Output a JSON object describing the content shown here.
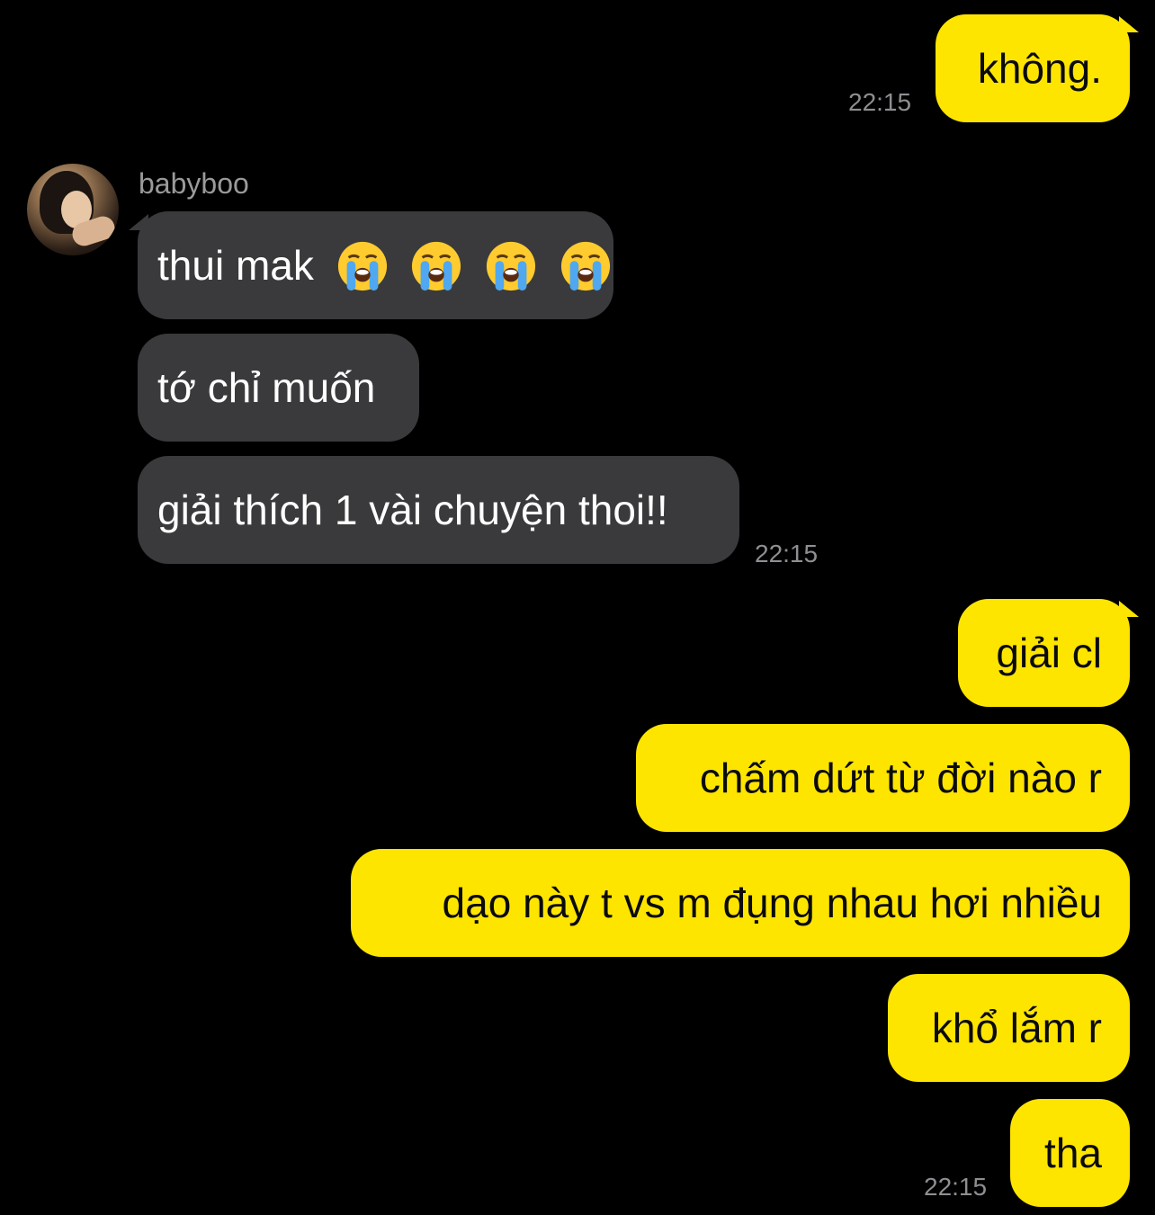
{
  "conversation": {
    "contact_name": "babyboo",
    "messages": [
      {
        "id": "m1",
        "from": "me",
        "text": "không."
      },
      {
        "id": "m2",
        "from": "them",
        "text": "thui mak",
        "emoji": [
          "loudly-crying-face",
          "loudly-crying-face",
          "loudly-crying-face",
          "loudly-crying-face"
        ]
      },
      {
        "id": "m3",
        "from": "them",
        "text": "tớ chỉ muốn"
      },
      {
        "id": "m4",
        "from": "them",
        "text": "giải thích 1 vài chuyện thoi!!"
      },
      {
        "id": "m5",
        "from": "me",
        "text": "giải cl"
      },
      {
        "id": "m6",
        "from": "me",
        "text": "chấm dứt từ đời nào r"
      },
      {
        "id": "m7",
        "from": "me",
        "text": "dạo này t vs m đụng nhau hơi nhiều"
      },
      {
        "id": "m8",
        "from": "me",
        "text": "khổ lắm r"
      },
      {
        "id": "m9",
        "from": "me",
        "text": "tha"
      }
    ],
    "timestamps": [
      "22:15",
      "22:15",
      "22:15"
    ]
  },
  "colors": {
    "background": "#000000",
    "sent_bubble": "#FEE500",
    "received_bubble": "#3a3a3c",
    "timestamp": "#8e8e93",
    "sender_name": "#9a9a9a"
  },
  "icons": {
    "avatar": "profile-photo",
    "reaction_emoji": "loudly-crying-face"
  }
}
